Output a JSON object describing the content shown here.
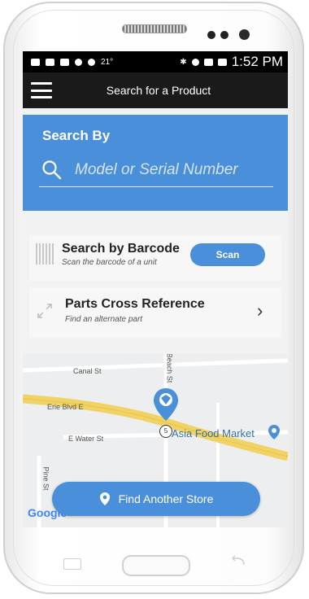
{
  "status_bar": {
    "time": "1:52 PM",
    "temp": "21°"
  },
  "header": {
    "title": "Search for a Product"
  },
  "search": {
    "heading": "Search By",
    "placeholder": "Model or Serial Number"
  },
  "barcode_card": {
    "title": "Search by Barcode",
    "subtitle": "Scan the barcode of a unit",
    "button": "Scan"
  },
  "cross_ref_card": {
    "title": "Parts Cross Reference",
    "subtitle": "Find an alternate part"
  },
  "map": {
    "streets": [
      "Canal St",
      "Erie Blvd E",
      "E Water St",
      "Pine St",
      "Beach St"
    ],
    "route_number": "5",
    "poi": "Asia Food Market",
    "attribution": "Google"
  },
  "find_store": {
    "label": "Find Another Store"
  },
  "colors": {
    "accent": "#4a8fd9",
    "title_bar": "#1a1a1a",
    "status_bar": "#000000"
  }
}
